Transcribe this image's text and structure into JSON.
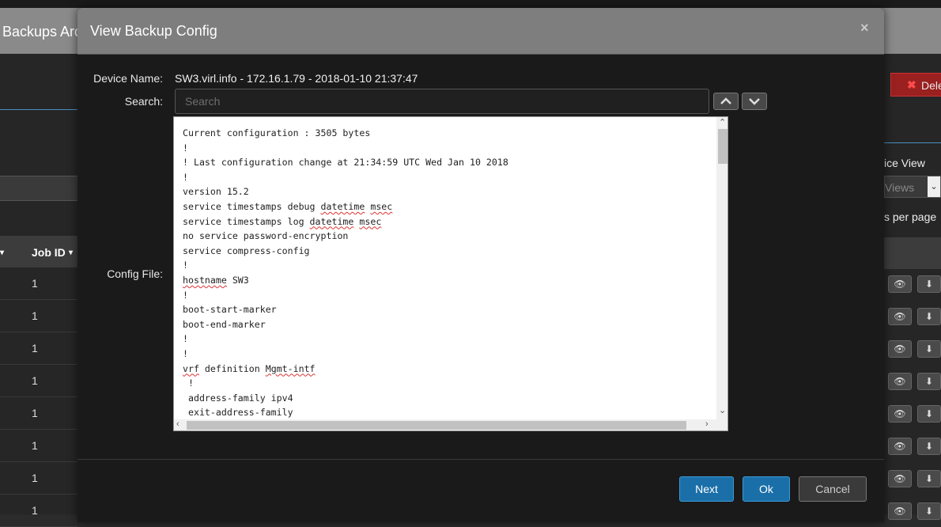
{
  "background": {
    "app_title": "Backups Arc",
    "job_id_header": "Job ID",
    "job_ids": [
      "1",
      "1",
      "1",
      "1",
      "1",
      "1",
      "1",
      "1"
    ],
    "delete_label": "Dele",
    "device_view_label": "ice View",
    "views_select": "Views",
    "per_page_label": "s per page"
  },
  "modal": {
    "title": "View Backup Config",
    "close": "×",
    "device_name_label": "Device Name:",
    "device_name_value": "SW3.virl.info - 172.16.1.79 - 2018-01-10 21:37:47",
    "search_label": "Search:",
    "search_placeholder": "Search",
    "config_label": "Config File:",
    "config_lines": [
      "Current configuration : 3505 bytes",
      "!",
      "! Last configuration change at 21:34:59 UTC Wed Jan 10 2018",
      "!",
      "version 15.2",
      "service timestamps debug datetime msec",
      "service timestamps log datetime msec",
      "no service password-encryption",
      "service compress-config",
      "!",
      "hostname SW3",
      "!",
      "boot-start-marker",
      "boot-end-marker",
      "!",
      "!",
      "vrf definition Mgmt-intf",
      " !",
      " address-family ipv4",
      " exit-address-family"
    ],
    "buttons": {
      "next": "Next",
      "ok": "Ok",
      "cancel": "Cancel"
    }
  }
}
